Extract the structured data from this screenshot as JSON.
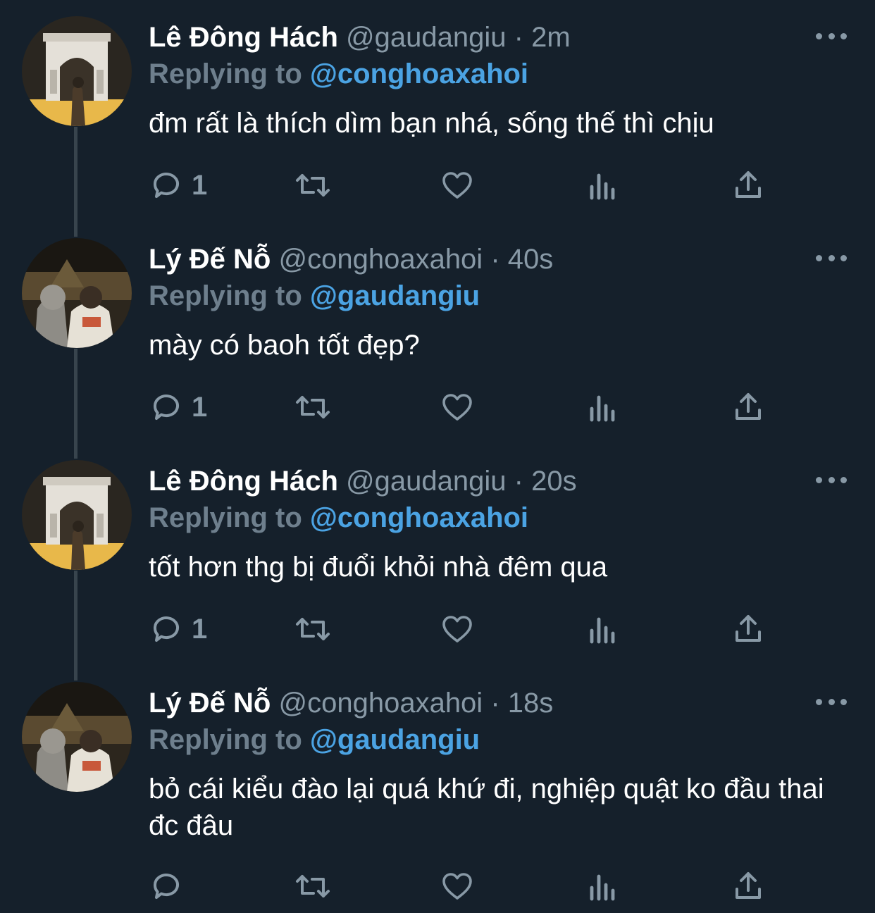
{
  "tweets": [
    {
      "name": "Lê Đông Hách",
      "handle": "@gaudangiu",
      "time": "2m",
      "replying_label": "Replying to",
      "replying_to": "@conghoaxahoi",
      "text": "đm rất là thích dìm bạn nhá, sống thế thì chịu",
      "reply_count": "1",
      "avatar": "arc-de-triomphe-photo"
    },
    {
      "name": "Lý Đế Nỗ",
      "handle": "@conghoaxahoi",
      "time": "40s",
      "replying_label": "Replying to",
      "replying_to": "@gaudangiu",
      "text": "mày có baoh tốt đẹp?",
      "reply_count": "1",
      "avatar": "louvre-couple-photo"
    },
    {
      "name": "Lê Đông Hách",
      "handle": "@gaudangiu",
      "time": "20s",
      "replying_label": "Replying to",
      "replying_to": "@conghoaxahoi",
      "text": "tốt hơn thg bị đuổi khỏi nhà đêm qua",
      "reply_count": "1",
      "avatar": "arc-de-triomphe-photo"
    },
    {
      "name": "Lý Đế Nỗ",
      "handle": "@conghoaxahoi",
      "time": "18s",
      "replying_label": "Replying to",
      "replying_to": "@gaudangiu",
      "text": "bỏ cái kiểu đào lại quá khứ đi, nghiệp quật ko đầu thai đc đâu",
      "reply_count": "",
      "avatar": "louvre-couple-photo"
    }
  ],
  "separator": "·",
  "colors": {
    "background": "#15202b",
    "secondary_text": "#8899a6",
    "mention": "#4ba3e3",
    "thread_line": "#38444d"
  },
  "icons": [
    "reply-icon",
    "retweet-icon",
    "like-icon",
    "analytics-icon",
    "share-icon",
    "more-icon"
  ]
}
